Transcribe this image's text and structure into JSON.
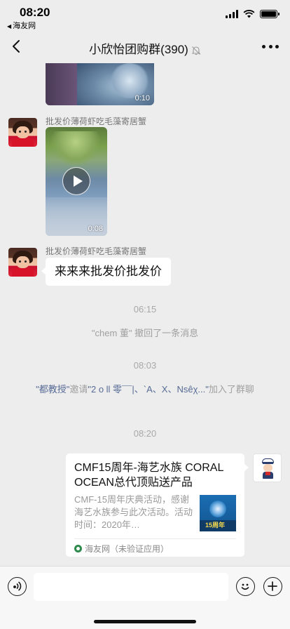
{
  "status_bar": {
    "time": "08:20",
    "back_app": "海友网"
  },
  "nav": {
    "title": "小欣怡团购群(390)"
  },
  "messages": [
    {
      "type": "video",
      "duration": "0:10"
    },
    {
      "type": "video",
      "sender": "批发价薄荷虾吃毛藻寄居蟹",
      "duration": "0:08"
    },
    {
      "type": "text",
      "sender": "批发价薄荷虾吃毛藻寄居蟹",
      "text": "来来来批发价批发价"
    }
  ],
  "system": {
    "time_1": "06:15",
    "recall_msg": "\"chem 董\" 撤回了一条消息",
    "time_2": "08:03",
    "invite_inviter": "\"都教授\"",
    "invite_verb": "邀请",
    "invite_invitees": "\"2 o ll 零¯¯|、`A、X、Nsêχ...\"",
    "invite_suffix": "加入了群聊",
    "time_3": "08:20"
  },
  "card": {
    "title": "CMF15周年-海艺水族 CORAL OCEAN总代顶贴送产品",
    "description": "CMF-15周年庆典活动，感谢海艺水族参与此次活动。活动时间：2020年…",
    "thumb_label": "15周年",
    "source": "海友网（未验证应用）"
  },
  "icons": {
    "back": "chevron-left-icon",
    "mute": "bell-off-icon",
    "more": "more-dots-icon",
    "voice": "voice-icon",
    "emoji": "emoji-icon",
    "plus": "plus-icon"
  }
}
